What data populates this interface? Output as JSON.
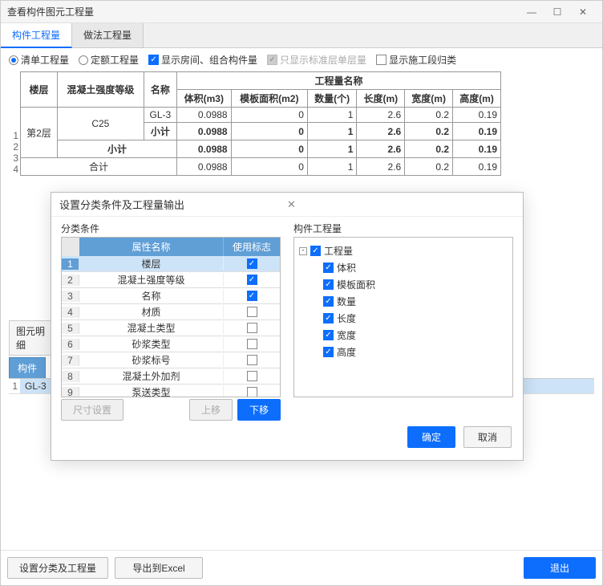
{
  "title": "查看构件图元工程量",
  "tabs": {
    "t1": "构件工程量",
    "t2": "做法工程量"
  },
  "toolbar": {
    "r1": "清单工程量",
    "r2": "定额工程量",
    "c1": "显示房间、组合构件量",
    "c2": "只显示标准层单层量",
    "c3": "显示施工段归类"
  },
  "table": {
    "h_floor": "楼层",
    "h_grade": "混凝土强度等级",
    "h_name": "名称",
    "h_group": "工程量名称",
    "h_vol": "体积(m3)",
    "h_tpl": "模板面积(m2)",
    "h_qty": "数量(个)",
    "h_len": "长度(m)",
    "h_wid": "宽度(m)",
    "h_hei": "高度(m)",
    "floor": "第2层",
    "grade": "C25",
    "r1": {
      "name": "GL-3",
      "vol": "0.0988",
      "tpl": "0",
      "qty": "1",
      "len": "2.6",
      "wid": "0.2",
      "hei": "0.19"
    },
    "r2": {
      "name": "小计",
      "vol": "0.0988",
      "tpl": "0",
      "qty": "1",
      "len": "2.6",
      "wid": "0.2",
      "hei": "0.19"
    },
    "r3": {
      "name": "小计",
      "vol": "0.0988",
      "tpl": "0",
      "qty": "1",
      "len": "2.6",
      "wid": "0.2",
      "hei": "0.19"
    },
    "r4": {
      "name": "合计",
      "vol": "0.0988",
      "tpl": "0",
      "qty": "1",
      "len": "2.6",
      "wid": "0.2",
      "hei": "0.19"
    }
  },
  "detail": {
    "label": "图元明细",
    "tab": "构件",
    "row": "GL-3"
  },
  "dialog": {
    "title": "设置分类条件及工程量输出",
    "panel1": "分类条件",
    "panel2": "构件工程量",
    "col_attr": "属性名称",
    "col_flag": "使用标志",
    "attrs": {
      "a1": "楼层",
      "a2": "混凝土强度等级",
      "a3": "名称",
      "a4": "材质",
      "a5": "混凝土类型",
      "a6": "砂浆类型",
      "a7": "砂浆标号",
      "a8": "混凝土外加剂",
      "a9": "泵送类型"
    },
    "btn_size": "尺寸设置",
    "btn_up": "上移",
    "btn_down": "下移",
    "tree": {
      "root": "工程量",
      "n1": "体积",
      "n2": "模板面积",
      "n3": "数量",
      "n4": "长度",
      "n5": "宽度",
      "n6": "高度"
    },
    "ok": "确定",
    "cancel": "取消"
  },
  "footer": {
    "b1": "设置分类及工程量",
    "b2": "导出到Excel",
    "b3": "退出"
  }
}
